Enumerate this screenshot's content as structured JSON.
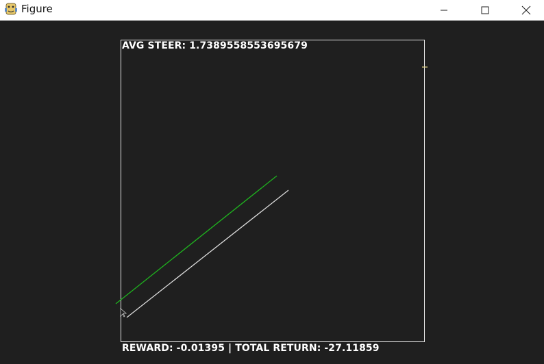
{
  "window": {
    "title": "Figure",
    "minimize_symbol": "—",
    "maximize_symbol": "☐",
    "close_symbol": "✕"
  },
  "hud": {
    "avg_steer": "AVG STEER: 1.7389558553695679",
    "reward_return": "REWARD: -0.01395 | TOTAL RETURN: -27.11859"
  },
  "colors": {
    "background": "#1f1f1f",
    "titlebar": "#ffffff",
    "frame": "#e6e6e6",
    "green_line": "#1fb31f",
    "white_line": "#dcdcdc",
    "marker": "#e8d88a"
  },
  "icons": {
    "app": "python-icon",
    "cursor": "mouse-cursor-icon"
  }
}
